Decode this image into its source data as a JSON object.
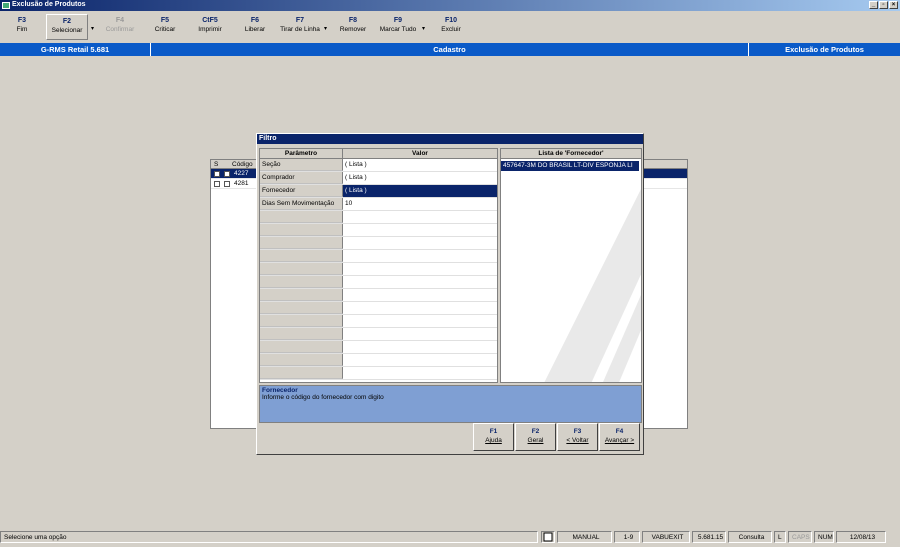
{
  "window": {
    "title": "Exclusão de Produtos"
  },
  "toolbar": {
    "buttons": [
      {
        "key": "F3",
        "label": "Fim"
      },
      {
        "key": "F2",
        "label": "Selecionar"
      },
      {
        "key": "F4",
        "label": "Confirmar"
      },
      {
        "key": "F5",
        "label": "Criticar"
      },
      {
        "key": "CtF5",
        "label": "Imprimir"
      },
      {
        "key": "F6",
        "label": "Liberar"
      },
      {
        "key": "F7",
        "label": "Tirar de Linha"
      },
      {
        "key": "F8",
        "label": "Remover"
      },
      {
        "key": "F9",
        "label": "Marcar Tudo"
      },
      {
        "key": "F10",
        "label": "Excluir"
      }
    ]
  },
  "infobar": {
    "app": "G-RMS Retail 5.681",
    "section": "Cadastro",
    "screen": "Exclusão de Produtos"
  },
  "background_grid": {
    "headers": [
      "S",
      "Código"
    ],
    "rows": [
      {
        "code": "4227"
      },
      {
        "code": "4281"
      }
    ]
  },
  "dialog": {
    "title": "Filtro",
    "param_header": "Parâmetro",
    "value_header": "Valor",
    "params": [
      {
        "name": "Seção",
        "value": "( Lista )"
      },
      {
        "name": "Comprador",
        "value": "( Lista )"
      },
      {
        "name": "Fornecedor",
        "value": "( Lista )"
      },
      {
        "name": "Dias Sem Movimentação",
        "value": "10"
      }
    ],
    "list_header": "Lista de 'Fornecedor'",
    "list_items": [
      "457647-3M DO BRASIL LT-DIV ESPONJA LI"
    ],
    "help_title": "Fornecedor",
    "help_text": "Informe o código do fornecedor com digito",
    "buttons": [
      {
        "key": "F1",
        "label": "Ajuda"
      },
      {
        "key": "F2",
        "label": "Geral"
      },
      {
        "key": "F3",
        "label": "< Voltar"
      },
      {
        "key": "F4",
        "label": "Avançar >"
      }
    ]
  },
  "statusbar": {
    "message": "Selecione uma opção",
    "mode": "MANUAL",
    "range": "1-9",
    "program": "VABUEXIT",
    "version": "5.681.15",
    "action": "Consulta",
    "l": "L",
    "caps": "CAPS",
    "num": "NUM",
    "date": "12/08/13"
  }
}
